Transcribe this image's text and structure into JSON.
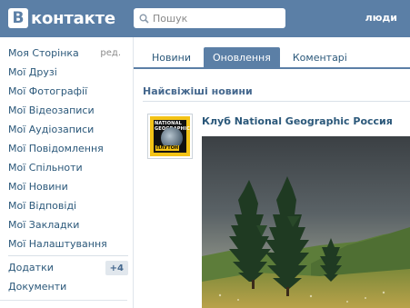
{
  "header": {
    "logo_box": "В",
    "logo_text": "контакте",
    "search_placeholder": "Пошук",
    "people_link": "люди"
  },
  "sidebar": {
    "items": [
      {
        "label": "Моя Сторінка",
        "edit": "ред."
      },
      {
        "label": "Мої Друзі"
      },
      {
        "label": "Мої Фотографії"
      },
      {
        "label": "Мої Відеозаписи"
      },
      {
        "label": "Мої Аудіозаписи"
      },
      {
        "label": "Мої Повідомлення"
      },
      {
        "label": "Мої Спільноти"
      },
      {
        "label": "Мої Новини"
      },
      {
        "label": "Мої Відповіді"
      },
      {
        "label": "Мої Закладки"
      },
      {
        "label": "Мої Налаштування"
      }
    ],
    "extra": [
      {
        "label": "Додатки",
        "badge": "+4"
      },
      {
        "label": "Документи"
      }
    ]
  },
  "tabs": [
    {
      "label": "Новини",
      "active": false
    },
    {
      "label": "Оновлення",
      "active": true
    },
    {
      "label": "Коментарі",
      "active": false
    }
  ],
  "feed": {
    "section_title": "Найсвіжіші новини",
    "post": {
      "author": "Клуб National Geographic Россия",
      "avatar_text_top": "NATIONAL GEOGRAPHIC",
      "avatar_text_bottom": "ПЛУТОН"
    }
  },
  "colors": {
    "brand": "#5b7fa6",
    "link": "#2b587a",
    "section": "#45688e"
  }
}
